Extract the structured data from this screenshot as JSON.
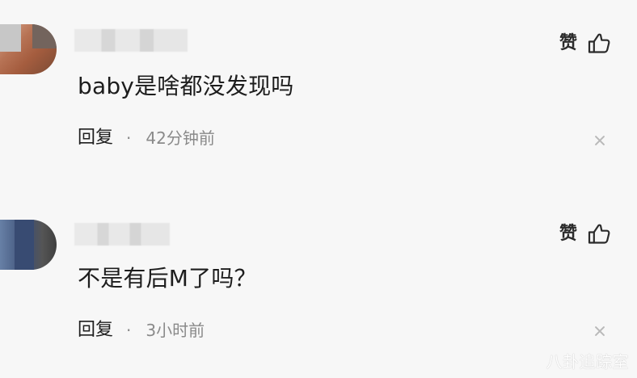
{
  "comments": [
    {
      "like_label": "赞",
      "text": "baby是啥都没发现吗",
      "reply_label": "回复",
      "dot": "·",
      "time": "42分钟前"
    },
    {
      "like_label": "赞",
      "text": "不是有后M了吗？",
      "reply_label": "回复",
      "dot": "·",
      "time": "3小时前"
    }
  ],
  "watermark": "八卦追踪室",
  "icons": {
    "like": "thumbs-up-icon",
    "close": "close-icon"
  },
  "colors": {
    "background": "#f7f7f7",
    "primary_text": "#1d1d1d",
    "secondary_text": "#8a8a8a",
    "icon": "#2b2b2b"
  }
}
